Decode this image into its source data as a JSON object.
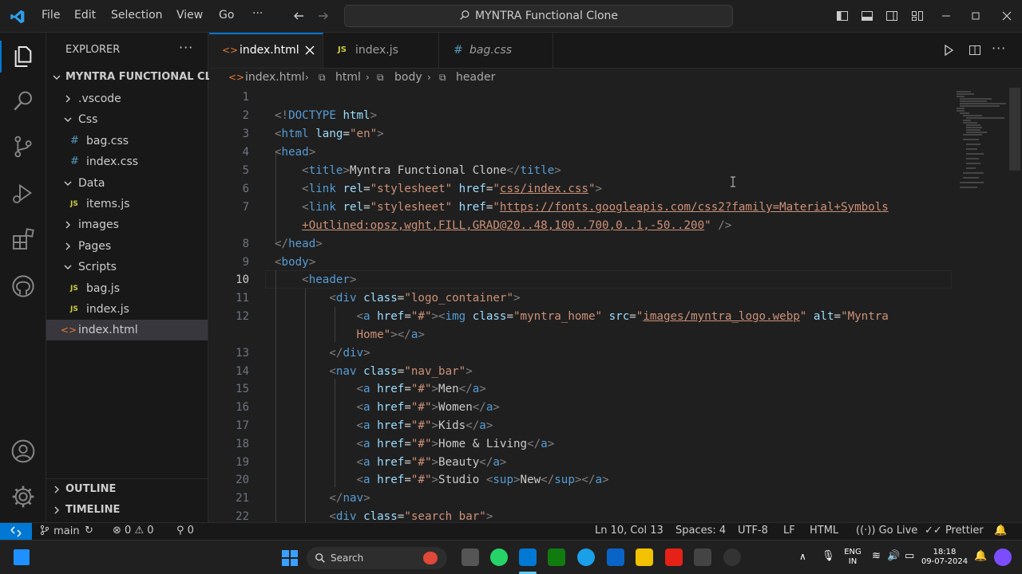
{
  "menu": {
    "file": "File",
    "edit": "Edit",
    "selection": "Selection",
    "view": "View",
    "go": "Go",
    "more": "···"
  },
  "command_center": {
    "title": "MYNTRA Functional Clone"
  },
  "explorer": {
    "header": "EXPLORER",
    "root": "MYNTRA FUNCTIONAL CL...",
    "items": [
      {
        "label": ".vscode",
        "kind": "folder-collapsed"
      },
      {
        "label": "Css",
        "kind": "folder-open"
      },
      {
        "label": "bag.css",
        "kind": "css"
      },
      {
        "label": "index.css",
        "kind": "css"
      },
      {
        "label": "Data",
        "kind": "folder-open"
      },
      {
        "label": "items.js",
        "kind": "js"
      },
      {
        "label": "images",
        "kind": "folder-collapsed"
      },
      {
        "label": "Pages",
        "kind": "folder-collapsed"
      },
      {
        "label": "Scripts",
        "kind": "folder-open"
      },
      {
        "label": "bag.js",
        "kind": "js"
      },
      {
        "label": "index.js",
        "kind": "js"
      },
      {
        "label": "index.html",
        "kind": "html"
      }
    ],
    "outline": "OUTLINE",
    "timeline": "TIMELINE"
  },
  "tabs": [
    {
      "label": "index.html",
      "icon": "<>",
      "active": true
    },
    {
      "label": "index.js",
      "icon": "JS",
      "active": false
    },
    {
      "label": "bag.css",
      "icon": "#",
      "active": false
    }
  ],
  "breadcrumb": [
    "index.html",
    "html",
    "body",
    "header"
  ],
  "editor": {
    "current_line": 10,
    "line_numbers": [
      "1",
      "2",
      "3",
      "4",
      "5",
      "6",
      "7",
      "",
      "8",
      "9",
      "10",
      "11",
      "12",
      "",
      "13",
      "14",
      "15",
      "16",
      "17",
      "18",
      "19",
      "20",
      "21",
      "22"
    ]
  },
  "statusbar": {
    "branch": "main",
    "errors": "0",
    "warnings": "0",
    "ports": "0",
    "position": "Ln 10, Col 13",
    "spaces": "Spaces: 4",
    "encoding": "UTF-8",
    "eol": "LF",
    "language": "HTML",
    "golive": "Go Live",
    "prettier": "Prettier"
  },
  "taskbar": {
    "search": "Search",
    "lang_top": "ENG",
    "lang_bottom": "IN",
    "time": "18:18",
    "date": "09-07-2024"
  },
  "colors": {
    "accent": "#0078d4",
    "tag": "#569cd6",
    "attr": "#9cdcfe",
    "string": "#ce9178"
  }
}
